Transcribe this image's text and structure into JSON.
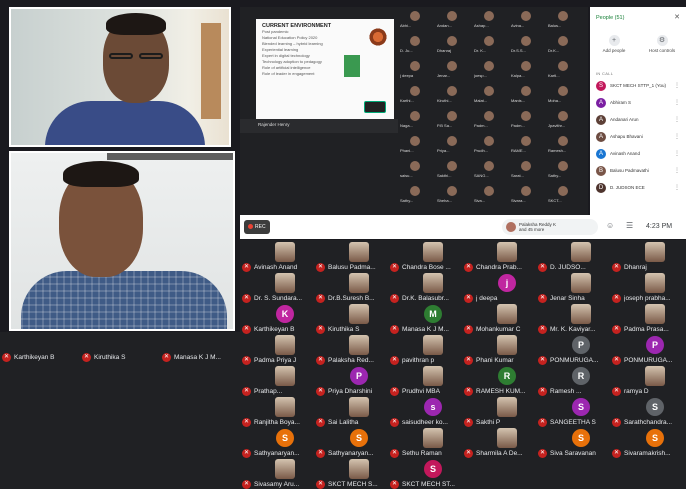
{
  "share": {
    "slide": {
      "title": "CURRENT ENVIRONMENT",
      "lines": [
        "Post pandemic",
        "National Education Policy 2020",
        "Blended learning – hybrid learning",
        "Experiential learning",
        "Expert in digital technology",
        "Technology adoption to pedagogy",
        "Role of artificial intelligence",
        "Role of leader in engagement"
      ]
    },
    "presenter_name": "Rajender Henry",
    "mini_tiles": [
      "Abhi...",
      "Andan...",
      "Ashap...",
      "Avina...",
      "Balus...",
      "D. Ju...",
      "Dhanraj",
      "Dr. K...",
      "Dr.S.S...",
      "Dr.K...",
      "j deepa",
      "Jenar...",
      "joesp...",
      "Kalpa...",
      "Kartl...",
      "Karthi...",
      "Kiruthi...",
      "Malat...",
      "Manis...",
      "Moha...",
      "Naga...",
      "P.B Sa...",
      "Padm...",
      "Padm...",
      "Jpavithr...",
      "Phani...",
      "Priya...",
      "Prudh...",
      "RAME...",
      "Ramesh...",
      "saisu...",
      "Sakthi...",
      "SANG...",
      "Sarat...",
      "Sathy...",
      "Sathy...",
      "Sheha...",
      "Siva...",
      "Sivara...",
      "SKCT..."
    ]
  },
  "people_panel": {
    "title": "People (51)",
    "actions": [
      "Add people",
      "Host controls"
    ],
    "section_label": "IN CALL",
    "participants": [
      {
        "initial": "S",
        "name": "SKCT MECH STTP_1 (You)",
        "color": "#c2185b"
      },
      {
        "initial": "A",
        "name": "Abhiram S",
        "color": "#7b1fa2"
      },
      {
        "initial": "A",
        "name": "Andanari Arun",
        "color": "#5d4037"
      },
      {
        "initial": "A",
        "name": "Ashapu Bhavani",
        "color": "#6d4c41"
      },
      {
        "initial": "A",
        "name": "Avinash Anand",
        "color": "#1976d2"
      },
      {
        "initial": "B",
        "name": "Balusu Padmavathi",
        "color": "#795548"
      },
      {
        "initial": "D",
        "name": "D. JUDSON ECE",
        "color": "#4e342e"
      }
    ]
  },
  "control_bar": {
    "rec_label": "REC",
    "raised_hand_name": "Palaksha Reddy K",
    "raised_hand_more": "and 45 more",
    "time": "4:23 PM"
  },
  "grid_tiles": [
    {
      "name": "Avinash Anand",
      "initial": "",
      "color": ""
    },
    {
      "name": "Balusu Padma...",
      "initial": "",
      "color": ""
    },
    {
      "name": "Chandra Bose ...",
      "initial": "",
      "color": ""
    },
    {
      "name": "Chandra Prab...",
      "initial": "",
      "color": ""
    },
    {
      "name": "D. JUDSO...",
      "initial": "",
      "color": ""
    },
    {
      "name": "Dhanraj",
      "initial": "",
      "color": ""
    },
    {
      "name": "Dr. S. Sundara...",
      "initial": "",
      "color": ""
    },
    {
      "name": "Dr.B.Suresh B...",
      "initial": "",
      "color": ""
    },
    {
      "name": "Dr.K. Balasubr...",
      "initial": "",
      "color": ""
    },
    {
      "name": "j deepa",
      "initial": "j",
      "color": "#c026a0"
    },
    {
      "name": "Jenar Sinha",
      "initial": "",
      "color": ""
    },
    {
      "name": "joseph prabha...",
      "initial": "",
      "color": ""
    },
    {
      "name": "Karthikeyan B",
      "initial": "K",
      "color": "#c026a0"
    },
    {
      "name": "Kiruthika S",
      "initial": "",
      "color": ""
    },
    {
      "name": "Manasa K J M...",
      "initial": "M",
      "color": "#2e7d32"
    },
    {
      "name": "Mohankumar C",
      "initial": "",
      "color": ""
    },
    {
      "name": "Mr. K. Kaviyar...",
      "initial": "",
      "color": ""
    },
    {
      "name": "Padma Prasa...",
      "initial": "",
      "color": ""
    },
    {
      "name": "Padma Priya J",
      "initial": "",
      "color": ""
    },
    {
      "name": "Palaksha Red...",
      "initial": "",
      "color": ""
    },
    {
      "name": "pavithran p",
      "initial": "",
      "color": ""
    },
    {
      "name": "Phani Kumar",
      "initial": "",
      "color": ""
    },
    {
      "name": "PONMURUGA...",
      "initial": "P",
      "color": "#5f6368"
    },
    {
      "name": "PONMURUGA...",
      "initial": "P",
      "color": "#9c27b0"
    },
    {
      "name": "Prathap...",
      "initial": "",
      "color": ""
    },
    {
      "name": "Priya Dharshini",
      "initial": "P",
      "color": "#9c27b0"
    },
    {
      "name": "Prudhvi MBA",
      "initial": "",
      "color": ""
    },
    {
      "name": "RAMESH KUM...",
      "initial": "R",
      "color": "#2e7d32"
    },
    {
      "name": "Ramesh ...",
      "initial": "R",
      "color": "#5f6368"
    },
    {
      "name": "ramya D",
      "initial": "",
      "color": ""
    },
    {
      "name": "Ranjitha Boya...",
      "initial": "",
      "color": ""
    },
    {
      "name": "Sai Lalitha",
      "initial": "",
      "color": ""
    },
    {
      "name": "saisudheer ko...",
      "initial": "s",
      "color": "#9c27b0"
    },
    {
      "name": "Sakthi P",
      "initial": "",
      "color": ""
    },
    {
      "name": "SANGEETHA S",
      "initial": "S",
      "color": "#9c27b0"
    },
    {
      "name": "Sarathchandra...",
      "initial": "S",
      "color": "#5f6368"
    },
    {
      "name": "Sathyanaryan...",
      "initial": "S",
      "color": "#e8710a"
    },
    {
      "name": "Sathyanaryan...",
      "initial": "S",
      "color": "#e8710a"
    },
    {
      "name": "Sethu Raman",
      "initial": "",
      "color": ""
    },
    {
      "name": "Sharmila A De...",
      "initial": "",
      "color": ""
    },
    {
      "name": "Siva Saravanan",
      "initial": "S",
      "color": "#e8710a"
    },
    {
      "name": "Sivaramakrish...",
      "initial": "S",
      "color": "#e8710a"
    },
    {
      "name": "Sivasamy Aru...",
      "initial": "",
      "color": ""
    },
    {
      "name": "SKCT MECH S...",
      "initial": "",
      "color": ""
    },
    {
      "name": "SKCT MECH ST...",
      "initial": "S",
      "color": "#c2185b"
    }
  ],
  "left_strip_names": [
    "Karthikeyan B",
    "Kiruthika S",
    "Manasa K J M..."
  ]
}
